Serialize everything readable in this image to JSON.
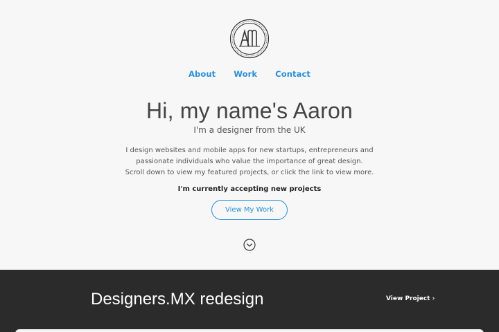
{
  "logo": {
    "icon": "am-monogram-logo"
  },
  "nav": {
    "items": [
      "About",
      "Work",
      "Contact"
    ]
  },
  "hero": {
    "title": "Hi, my name's Aaron",
    "subtitle": "I'm a designer from the UK",
    "description": [
      "I design websites and mobile apps for new startups, entrepreneurs and",
      "passionate individuals who value the importance of great design.",
      "Scroll down to view my featured projects, or click the link to view more."
    ],
    "accepting": "I'm currently accepting new projects",
    "cta_label": "View My Work",
    "scroll_icon": "chevron-down-circle-icon"
  },
  "featured": {
    "title": "Designers.MX redesign",
    "link_label": "View Project ›"
  },
  "colors": {
    "accent": "#2a8fd6",
    "background": "#f7f7f7",
    "dark_section": "#2b2b2b"
  }
}
